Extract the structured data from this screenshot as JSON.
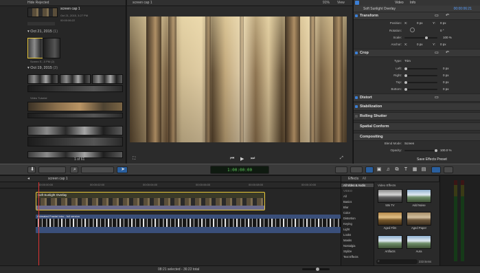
{
  "browser": {
    "event_name": "Hide Rejected",
    "top_clip": {
      "title": "screen cap 1",
      "date": "Oct 21, 2015, 3:27 PM",
      "duration": "00:00:06:22"
    },
    "sections": [
      {
        "date": "Oct 21, 2015",
        "count": "(1)"
      },
      {
        "date": "Oct 19, 2015",
        "count": "(3)"
      }
    ],
    "clip_label": "Screen S...0 PM (2)",
    "group_label": "Video Tutorial"
  },
  "viewer": {
    "title": "screen cap 1",
    "zoom": "91%",
    "view_menu": "View",
    "page_indicator": "1 of 61"
  },
  "inspector": {
    "tabs": [
      "Video",
      "Info"
    ],
    "clip_title": "Soft Sunlight Overlay",
    "clip_time": "00:00:06:21",
    "sections": {
      "transform": "Transform",
      "crop": "Crop",
      "distort": "Distort",
      "stabilization": "Stabilization",
      "rolling_shutter": "Rolling Shutter",
      "spatial_conform": "Spatial Conform",
      "compositing": "Compositing"
    },
    "transform_props": [
      {
        "label": "Position:",
        "x_label": "X:",
        "x": "0 px",
        "y_label": "Y:",
        "y": "0 px"
      },
      {
        "label": "Rotation:",
        "value": "0 °"
      },
      {
        "label": "Scale:",
        "value": "100 %"
      },
      {
        "label": "Anchor:",
        "x_label": "X:",
        "x": "0 px",
        "y_label": "Y:",
        "y": "0 px"
      }
    ],
    "crop_props": [
      {
        "label": "Type:",
        "value": "Trim"
      },
      {
        "label": "Left:",
        "value": "0 px"
      },
      {
        "label": "Right:",
        "value": "0 px"
      },
      {
        "label": "Top:",
        "value": "0 px"
      },
      {
        "label": "Bottom:",
        "value": "0 px"
      }
    ],
    "blend_mode_label": "Blend Mode:",
    "blend_mode_value": "Screen",
    "opacity_label": "Opacity:",
    "opacity_value": "100.0 %",
    "save_preset": "Save Effects Preset"
  },
  "toolbar": {
    "timecode": "1:00:00:00"
  },
  "timeline": {
    "project_name": "screen cap 1",
    "ruler": [
      "00:00:00:00",
      "00:00:02:00",
      "00:00:04:00",
      "00:00:06:00",
      "00:00:08:00",
      "00:00:10:00"
    ],
    "title_clip": "Soft Sunlight Overlay",
    "primary_clip": "Animated Fractal Intro - full version"
  },
  "effects": {
    "header": "Effects",
    "header_sub": "All",
    "section_title": "Video Effects",
    "categories": [
      {
        "label": "All Video & Audio",
        "selected": true,
        "header": false
      },
      {
        "label": "VIDEO",
        "selected": false,
        "header": true
      },
      {
        "label": "All",
        "selected": false,
        "header": false
      },
      {
        "label": "Basics",
        "selected": false,
        "header": false
      },
      {
        "label": "Blur",
        "selected": false,
        "header": false
      },
      {
        "label": "Color",
        "selected": false,
        "header": false
      },
      {
        "label": "Distortion",
        "selected": false,
        "header": false
      },
      {
        "label": "Keying",
        "selected": false,
        "header": false
      },
      {
        "label": "Light",
        "selected": false,
        "header": false
      },
      {
        "label": "Looks",
        "selected": false,
        "header": false
      },
      {
        "label": "Masks",
        "selected": false,
        "header": false
      },
      {
        "label": "Nostalgia",
        "selected": false,
        "header": false
      },
      {
        "label": "Stylize",
        "selected": false,
        "header": false
      },
      {
        "label": "Text Effects",
        "selected": false,
        "header": false
      }
    ],
    "items": [
      "50s TV",
      "Add Noise",
      "Aged Film",
      "Aged Paper",
      "Artifacts",
      "Aura"
    ],
    "item_count": "233 items"
  },
  "status": {
    "text": "08:21 selected - 36:22 total"
  },
  "colors": {
    "accent_blue": "#3b7fd6",
    "selection_yellow": "#e9c83a",
    "playhead_red": "#d33333",
    "timecode_green": "#5ec85a"
  }
}
